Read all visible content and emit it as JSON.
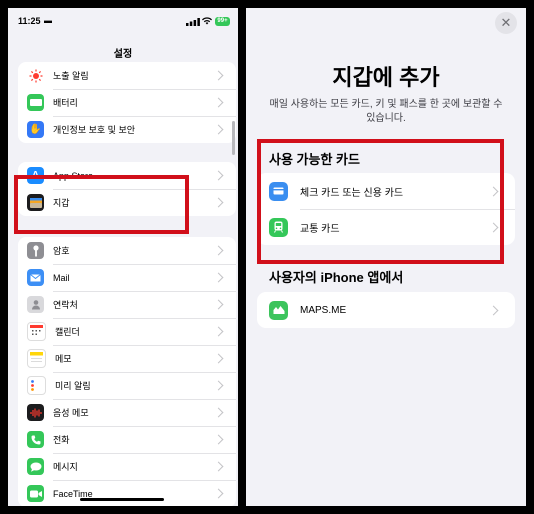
{
  "left": {
    "status_time": "11:25",
    "battery": "99+",
    "nav_title": "설정",
    "group1": [
      {
        "label": "노출 알림",
        "icon": "exposure-icon",
        "color": "#ffffff"
      },
      {
        "label": "배터리",
        "icon": "battery-icon",
        "color": "#34c759"
      },
      {
        "label": "개인정보 보호 및 보안",
        "icon": "hand-icon",
        "color": "#3478f6"
      }
    ],
    "group2": [
      {
        "label": "App Store",
        "icon": "app-store-icon",
        "color": "#1a8cff"
      },
      {
        "label": "지갑",
        "icon": "wallet-icon",
        "color": "#1c1c1e"
      }
    ],
    "group3": [
      {
        "label": "암호",
        "icon": "key-icon",
        "color": "#8e8e93"
      },
      {
        "label": "Mail",
        "icon": "mail-icon",
        "color": "#3d8ff5"
      },
      {
        "label": "연락처",
        "icon": "contacts-icon",
        "color": "#a9a9ae"
      },
      {
        "label": "캘린더",
        "icon": "calendar-icon",
        "color": "#ffffff"
      },
      {
        "label": "메모",
        "icon": "notes-icon",
        "color": "#ffd60a"
      },
      {
        "label": "미리 알림",
        "icon": "reminders-icon",
        "color": "#ffffff"
      },
      {
        "label": "음성 메모",
        "icon": "voice-memo-icon",
        "color": "#1c1c1e"
      },
      {
        "label": "전화",
        "icon": "phone-icon",
        "color": "#34c759"
      },
      {
        "label": "메시지",
        "icon": "messages-icon",
        "color": "#34c759"
      },
      {
        "label": "FaceTime",
        "icon": "facetime-icon",
        "color": "#34c759"
      }
    ]
  },
  "right": {
    "title": "지갑에 추가",
    "description": "매일 사용하는 모든 카드, 키 및 패스를 한 곳에 보관할 수 있습니다.",
    "section1": "사용 가능한 카드",
    "cards": [
      {
        "label": "체크 카드 또는 신용 카드",
        "icon": "credit-card-icon",
        "color": "#3a8ef0"
      },
      {
        "label": "교통 카드",
        "icon": "transit-icon",
        "color": "#34c759"
      }
    ],
    "section2": "사용자의 iPhone 앱에서",
    "apps": [
      {
        "label": "MAPS.ME",
        "icon": "maps-me-icon",
        "color": "#3cc45c"
      }
    ]
  },
  "colors": {
    "highlight": "#d10f1a"
  }
}
